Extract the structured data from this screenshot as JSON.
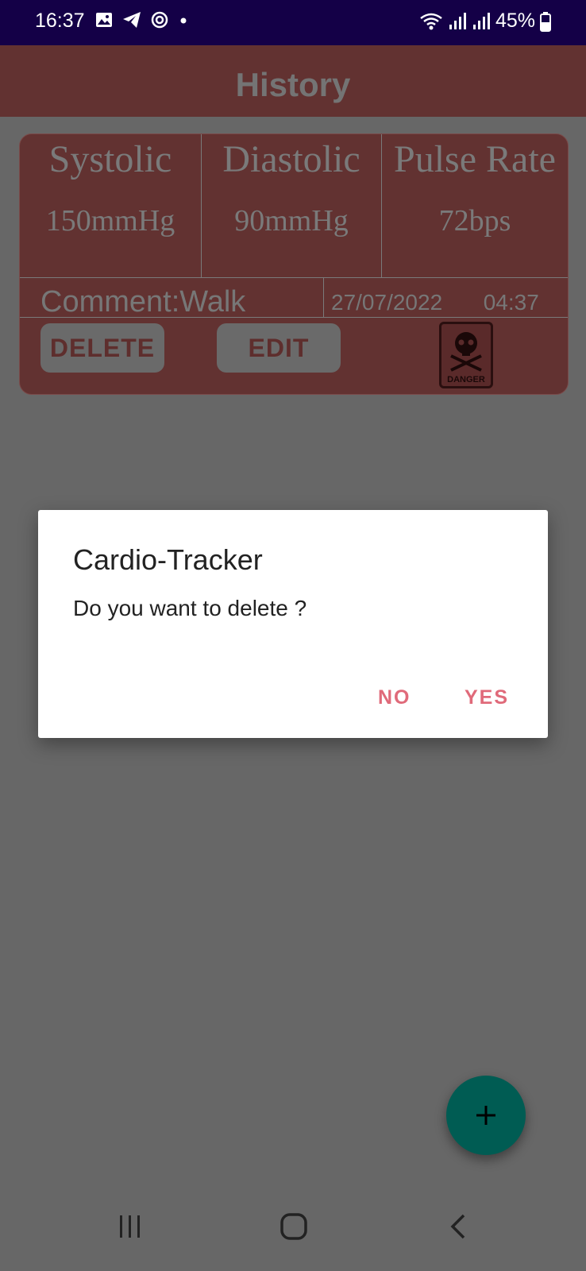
{
  "status_bar": {
    "time": "16:37",
    "battery": "45%",
    "left_icons": [
      "image-icon",
      "telegram-icon",
      "radar-icon",
      "dot-icon"
    ],
    "right_icons": [
      "wifi-icon",
      "signal-icon",
      "signal-icon",
      "battery-icon"
    ]
  },
  "appbar": {
    "title": "History"
  },
  "record": {
    "systolic_label": "Systolic",
    "systolic_value": "150mmHg",
    "diastolic_label": "Diastolic",
    "diastolic_value": "90mmHg",
    "pulse_label": "Pulse Rate",
    "pulse_value": "72bps",
    "comment": "Comment:Walk",
    "date": "27/07/2022",
    "time": "04:37",
    "delete_label": "DELETE",
    "edit_label": "EDIT",
    "badge_text": "DANGER"
  },
  "dialog": {
    "title": "Cardio-Tracker",
    "message": "Do you want to delete ?",
    "no_label": "NO",
    "yes_label": "YES",
    "accent_color": "#e06a7a"
  },
  "fab": {
    "icon": "plus-icon",
    "color": "#005c53"
  },
  "nav": {
    "icons": [
      "recents-icon",
      "home-icon",
      "back-icon"
    ]
  }
}
